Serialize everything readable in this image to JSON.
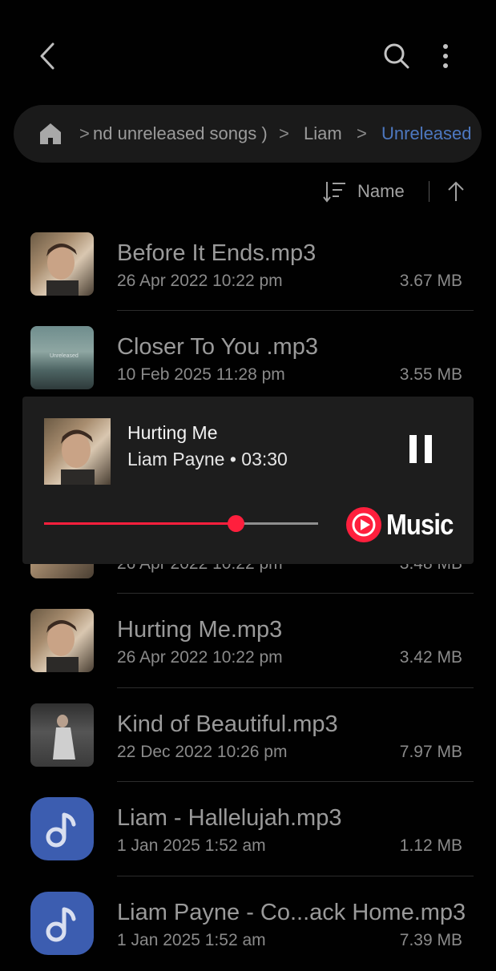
{
  "topbar": {
    "back_icon": "chevron-left-icon",
    "search_icon": "search-icon",
    "more_icon": "more-vertical-icon"
  },
  "breadcrumb": {
    "home_icon": "home-icon",
    "items": [
      "nd unreleased songs )",
      "Liam",
      "Unreleased"
    ],
    "separator": ">",
    "active_color": "#4d78c0"
  },
  "sort": {
    "label": "Name",
    "direction": "ascending"
  },
  "files": [
    {
      "name": "Before It Ends.mp3",
      "date": "26 Apr 2022 10:22 pm",
      "size": "3.67 MB",
      "thumb": "photo"
    },
    {
      "name": "Closer To You .mp3",
      "date": "10 Feb 2025 11:28 pm",
      "size": "3.55 MB",
      "thumb": "photo",
      "thumb_text": "Unreleased"
    },
    {
      "name": "",
      "date": "26 Apr 2022 10:22 pm",
      "size": "3.48 MB",
      "thumb": "photo"
    },
    {
      "name": "Hurting Me.mp3",
      "date": "26 Apr 2022 10:22 pm",
      "size": "3.42 MB",
      "thumb": "photo"
    },
    {
      "name": "Kind of Beautiful.mp3",
      "date": "22 Dec 2022 10:26 pm",
      "size": "7.97 MB",
      "thumb": "photo"
    },
    {
      "name": "Liam - Hallelujah.mp3",
      "date": "1 Jan 2025 1:52 am",
      "size": "1.12 MB",
      "thumb": "music-note-icon"
    },
    {
      "name": "Liam Payne - Co...ack Home.mp3",
      "date": "1 Jan 2025 1:52 am",
      "size": "7.39 MB",
      "thumb": "music-note-icon"
    }
  ],
  "player": {
    "title": "Hurting Me",
    "subtitle": "Liam Payne • 03:30",
    "progress": 0.7,
    "pause_icon": "pause-icon",
    "brand_icon": "youtube-music-icon",
    "brand_label": "Music",
    "progress_color": "#ff1f3d"
  },
  "colors": {
    "background": "#010101",
    "panel": "#1d1d1d",
    "accent": "#4d78c0",
    "app_icon": "#3c5db0"
  }
}
